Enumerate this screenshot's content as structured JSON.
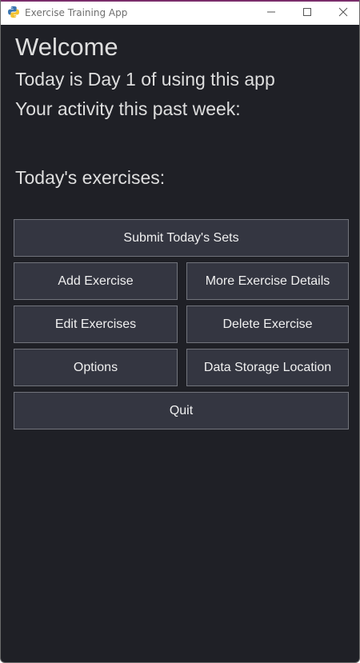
{
  "window": {
    "title": "Exercise Training App"
  },
  "main": {
    "welcome": "Welcome",
    "day_text": "Today is Day 1 of using this app",
    "activity_text": "Your activity this past week:",
    "todays_exercises": "Today's exercises:"
  },
  "buttons": {
    "submit": "Submit Today's Sets",
    "add": "Add Exercise",
    "more_details": "More Exercise Details",
    "edit": "Edit Exercises",
    "delete": "Delete Exercise",
    "options": "Options",
    "data_storage": "Data Storage Location",
    "quit": "Quit"
  },
  "icons": {
    "app": "python-icon",
    "minimize": "minimize-icon",
    "maximize": "maximize-icon",
    "close": "close-icon"
  },
  "colors": {
    "background": "#1f2026",
    "button_bg": "#343641",
    "button_border": "#72747c",
    "text": "#dedede"
  }
}
